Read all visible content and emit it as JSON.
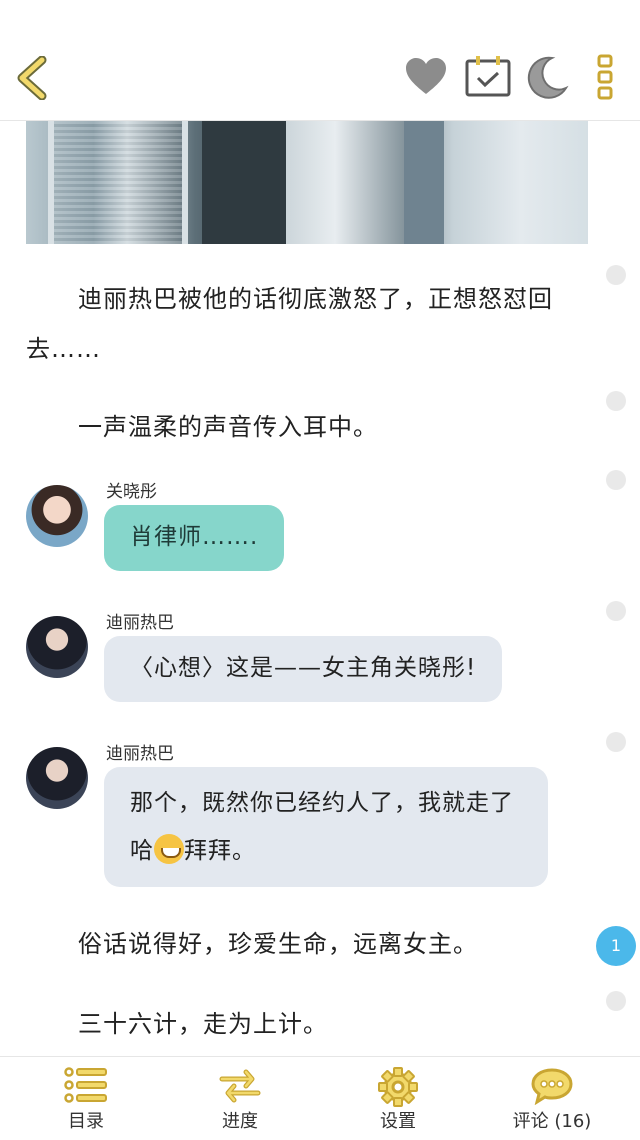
{
  "colors": {
    "accent": "#f2d96b",
    "icon_gray": "#8c8c8c",
    "bubble_green": "#86d6cb",
    "bubble_gray": "#e3e8ef",
    "badge_blue": "#4bb8ea"
  },
  "header": {
    "icons": [
      "back-icon",
      "heart-icon",
      "calendar-check-icon",
      "moon-icon",
      "more-icon"
    ]
  },
  "story": {
    "paragraph1": "迪丽热巴被他的话彻底激怒了，正想怒怼回去……",
    "paragraph2": "一声温柔的声音传入耳中。",
    "messages": [
      {
        "speaker": "关晓彤",
        "text": "肖律师……."
      },
      {
        "speaker": "迪丽热巴",
        "text": "〈心想〉这是——女主角关晓彤!"
      },
      {
        "speaker": "迪丽热巴",
        "text_before": "那个，既然你已经约人了，我就走了哈",
        "text_after": "拜拜。"
      }
    ],
    "paragraph3": "俗话说得好，珍爱生命，远离女主。",
    "paragraph4": "三十六计，走为上计。",
    "comment_badge": "1"
  },
  "nav": {
    "catalog": "目录",
    "progress": "进度",
    "settings": "设置",
    "comments": "评论 (16)"
  }
}
